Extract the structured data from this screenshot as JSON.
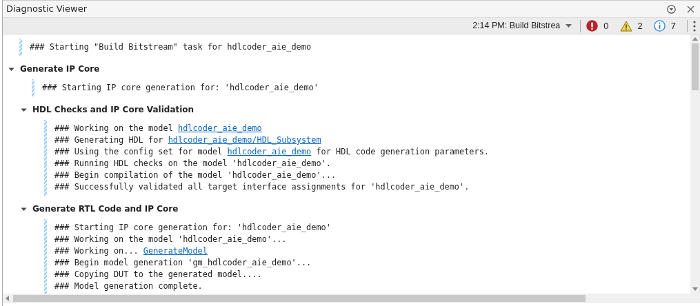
{
  "window": {
    "title": "Diagnostic Viewer"
  },
  "toolbar": {
    "run_selector": "2:14 PM: Build Bitstrea",
    "errors": "0",
    "warnings": "2",
    "infos": "7"
  },
  "log": [
    {
      "kind": "messages",
      "lines": [
        [
          {
            "kind": "text",
            "text": "### Starting \"Build Bitstream\" task for hdlcoder_aie_demo"
          }
        ]
      ]
    },
    {
      "kind": "section",
      "title": "Generate IP Core",
      "expanded": true,
      "children": [
        {
          "kind": "messages",
          "lines": [
            [
              {
                "kind": "text",
                "text": "### Starting IP core generation for: 'hdlcoder_aie_demo'"
              }
            ]
          ]
        },
        {
          "kind": "section",
          "title": "HDL Checks and IP Core Validation",
          "expanded": true,
          "children": [
            {
              "kind": "messages",
              "lines": [
                [
                  {
                    "kind": "text",
                    "text": "### Working on the model "
                  },
                  {
                    "kind": "link",
                    "text": "hdlcoder_aie_demo"
                  }
                ],
                [
                  {
                    "kind": "text",
                    "text": "### Generating HDL for "
                  },
                  {
                    "kind": "link",
                    "text": "hdlcoder_aie_demo/HDL_Subsystem"
                  }
                ],
                [
                  {
                    "kind": "text",
                    "text": "### Using the config set for model "
                  },
                  {
                    "kind": "link",
                    "text": "hdlcoder_aie_demo"
                  },
                  {
                    "kind": "text",
                    "text": " for HDL code generation parameters."
                  }
                ],
                [
                  {
                    "kind": "text",
                    "text": "### Running HDL checks on the model 'hdlcoder_aie_demo'."
                  }
                ],
                [
                  {
                    "kind": "text",
                    "text": "### Begin compilation of the model 'hdlcoder_aie_demo'..."
                  }
                ],
                [
                  {
                    "kind": "text",
                    "text": "### Successfully validated all target interface assignments for 'hdlcoder_aie_demo'."
                  }
                ]
              ]
            }
          ]
        },
        {
          "kind": "section",
          "title": "Generate RTL Code and IP Core",
          "expanded": true,
          "children": [
            {
              "kind": "messages",
              "lines": [
                [
                  {
                    "kind": "text",
                    "text": "### Starting IP core generation for: 'hdlcoder_aie_demo'"
                  }
                ],
                [
                  {
                    "kind": "text",
                    "text": "### Working on the model 'hdlcoder_aie_demo'..."
                  }
                ],
                [
                  {
                    "kind": "text",
                    "text": "### Working on... "
                  },
                  {
                    "kind": "link",
                    "text": "GenerateModel"
                  }
                ],
                [
                  {
                    "kind": "text",
                    "text": "### Begin model generation 'gm_hdlcoder_aie_demo'..."
                  }
                ],
                [
                  {
                    "kind": "text",
                    "text": "### Copying DUT to the generated model...."
                  }
                ],
                [
                  {
                    "kind": "text",
                    "text": "### Model generation complete."
                  }
                ]
              ]
            }
          ]
        }
      ]
    }
  ]
}
